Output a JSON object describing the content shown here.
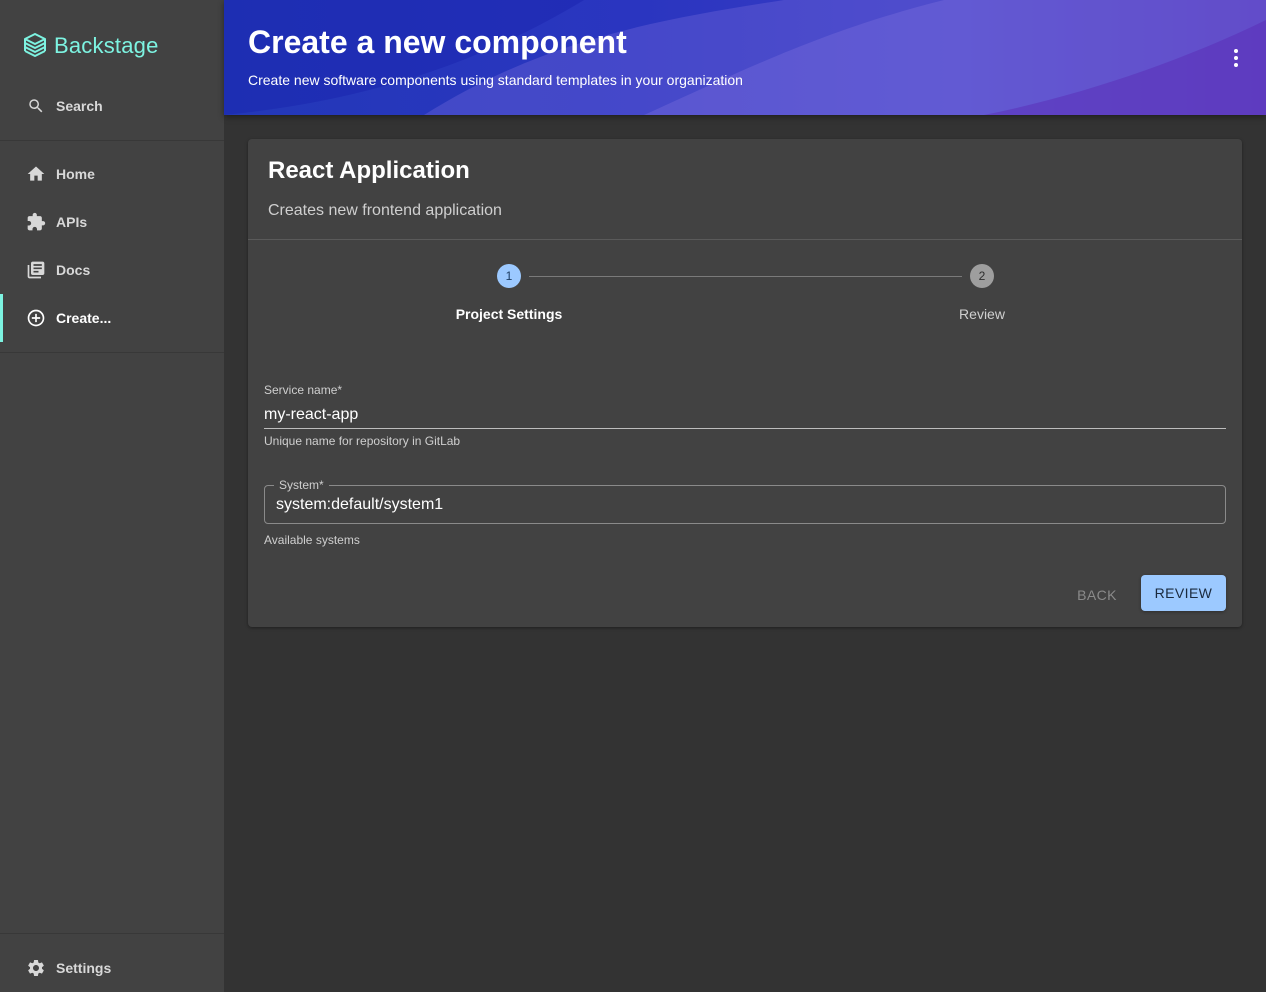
{
  "sidebar": {
    "logo_text": "Backstage",
    "search_label": "Search",
    "items": [
      {
        "label": "Home",
        "icon": "home-icon"
      },
      {
        "label": "APIs",
        "icon": "puzzle-icon"
      },
      {
        "label": "Docs",
        "icon": "library-books-icon"
      },
      {
        "label": "Create...",
        "icon": "add-circle-outline-icon",
        "active": true
      }
    ],
    "settings_label": "Settings"
  },
  "header": {
    "title": "Create a new component",
    "subtitle": "Create new software components using standard templates in your organization"
  },
  "template": {
    "title": "React Application",
    "description": "Creates new frontend application"
  },
  "stepper": {
    "steps": [
      {
        "number": "1",
        "label": "Project Settings",
        "active": true
      },
      {
        "number": "2",
        "label": "Review",
        "active": false
      }
    ]
  },
  "form": {
    "service_name": {
      "label": "Service name*",
      "value": "my-react-app",
      "help": "Unique name for repository in GitLab"
    },
    "system": {
      "label": "System*",
      "value": "system:default/system1",
      "help": "Available systems"
    }
  },
  "actions": {
    "back_label": "BACK",
    "review_label": "REVIEW"
  },
  "colors": {
    "accent": "#7df3e1",
    "primary_button": "#9cc9ff",
    "sidebar_bg": "#424242",
    "page_bg": "#333333",
    "header_gradient_start": "#2338b8",
    "header_gradient_end": "#3c1fb0"
  }
}
